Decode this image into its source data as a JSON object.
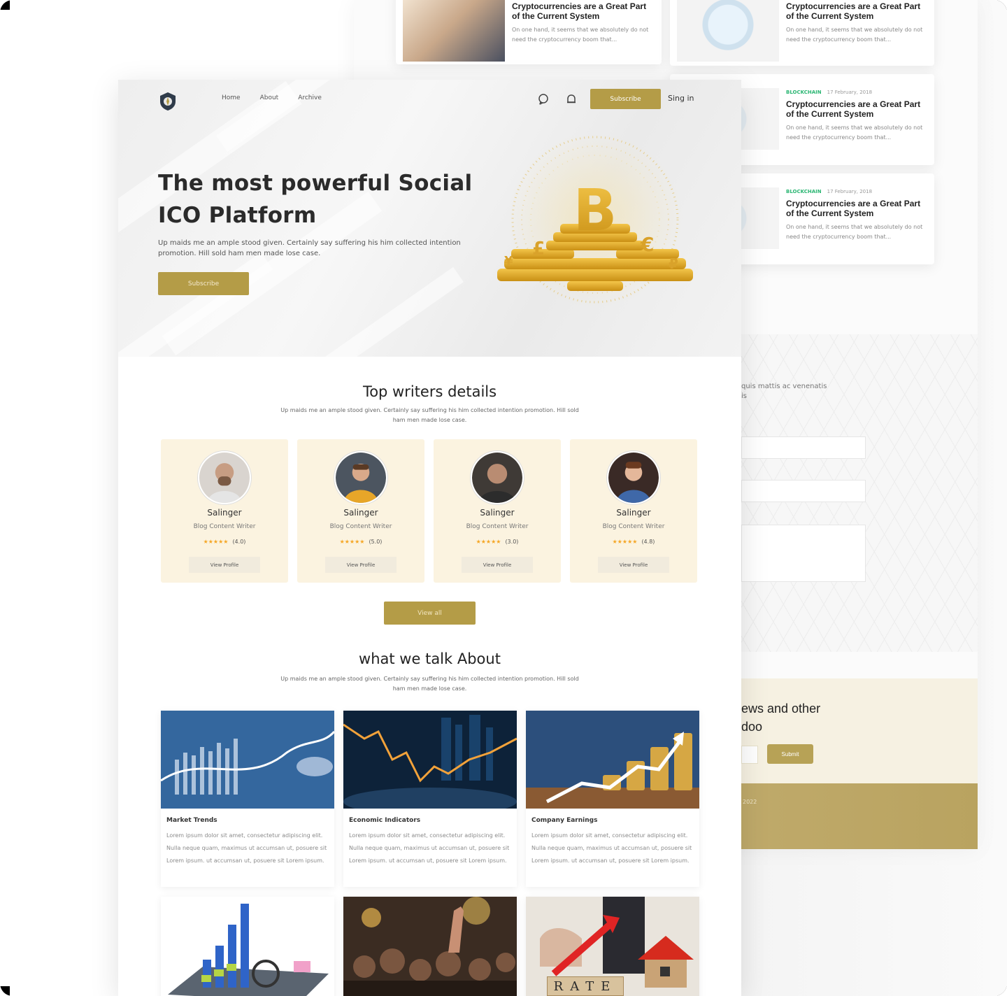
{
  "back_cards": [
    {
      "category": "",
      "date": "",
      "title": "Cryptocurrencies are a Great Part of the Current System",
      "desc": "On one hand, it seems that we absolutely do not need the cryptocurrency boom that..."
    },
    {
      "category": "",
      "date": "",
      "title": "Cryptocurrencies are a Great Part of the Current System",
      "desc": "On one hand, it seems that we absolutely do not need the cryptocurrency boom that..."
    },
    {
      "category": "BLOCKCHAIN",
      "date": "17 February, 2018",
      "title": "Cryptocurrencies are a Great Part of the Current System",
      "desc": "On one hand, it seems that we absolutely do not need the cryptocurrency boom that..."
    },
    {
      "category": "BLOCKCHAIN",
      "date": "17 February, 2018",
      "title": "Cryptocurrencies are a Great Part of the Current System",
      "desc": "On one hand, it seems that we absolutely do not need the cryptocurrency boom that..."
    }
  ],
  "contact": {
    "text_line1": "quis mattis ac venenatis",
    "text_line2": "is"
  },
  "newsletter": {
    "title_line1": "ews and other",
    "title_line2": "doo",
    "submit": "Submit"
  },
  "footer": {
    "text": "2022"
  },
  "nav": {
    "links": [
      "Home",
      "About",
      "Archive"
    ],
    "subscribe": "Subscribe",
    "login": "Sing in"
  },
  "hero": {
    "title_line1": "The most powerful Social",
    "title_line2": "ICO Platform",
    "subtitle": "Up maids me an ample stood given. Certainly say suffering his him collected intention promotion. Hill sold ham men made lose case.",
    "button": "Subscribe"
  },
  "writers_section": {
    "title": "Top writers details",
    "subtitle": "Up maids me an ample stood given. Certainly say suffering his him collected intention promotion. Hill sold ham men made lose case.",
    "view_all": "View all"
  },
  "writers": [
    {
      "name": "Salinger",
      "role": "Blog Content Writer",
      "stars": "★★★★★",
      "reviews": "(4.0)",
      "button": "View Profile"
    },
    {
      "name": "Salinger",
      "role": "Blog Content Writer",
      "stars": "★★★★★",
      "reviews": "(5.0)",
      "button": "View Profile"
    },
    {
      "name": "Salinger",
      "role": "Blog Content Writer",
      "stars": "★★★★★",
      "reviews": "(3.0)",
      "button": "View Profile"
    },
    {
      "name": "Salinger",
      "role": "Blog Content Writer",
      "stars": "★★★★★",
      "reviews": "(4.8)",
      "button": "View Profile"
    }
  ],
  "talk_section": {
    "title": "what we talk About",
    "subtitle": "Up maids me an ample stood given. Certainly say suffering his him collected intention promotion. Hill sold ham men made lose case."
  },
  "topics": [
    {
      "title": "Market Trends",
      "desc": "Lorem ipsum dolor sit amet, consectetur adipiscing elit. Nulla neque quam, maximus ut accumsan ut, posuere sit Lorem ipsum. ut accumsan ut, posuere sit Lorem ipsum."
    },
    {
      "title": "Economic Indicators",
      "desc": "Lorem ipsum dolor sit amet, consectetur adipiscing elit. Nulla neque quam, maximus ut accumsan ut, posuere sit Lorem ipsum. ut accumsan ut, posuere sit Lorem ipsum."
    },
    {
      "title": "Company Earnings",
      "desc": "Lorem ipsum dolor sit amet, consectetur adipiscing elit. Nulla neque quam, maximus ut accumsan ut, posuere sit Lorem ipsum. ut accumsan ut, posuere sit Lorem ipsum."
    }
  ],
  "rate_sign": "RATE",
  "colors": {
    "accent": "#b49c47",
    "card_bg": "#fbf3e0",
    "category": "#2bb673"
  }
}
